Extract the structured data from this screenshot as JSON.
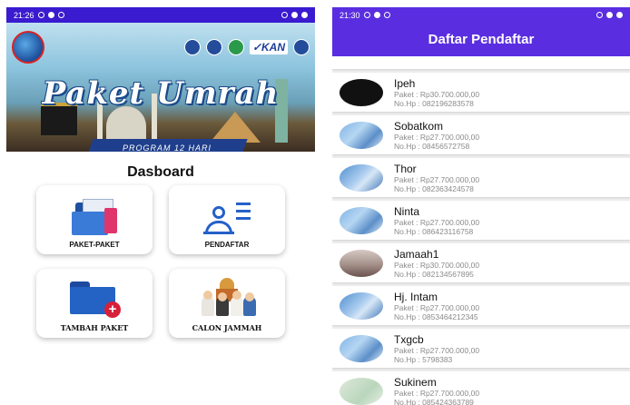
{
  "left_screen": {
    "status_time": "21:26",
    "banner": {
      "brand": "KAN",
      "title": "Paket Umrah",
      "program": "PROGRAM 12 HARI"
    },
    "dashboard_title": "Dasboard",
    "menu": [
      {
        "label": "PAKET-PAKET",
        "icon": "package-documents-icon"
      },
      {
        "label": "PENDAFTAR",
        "icon": "user-list-icon"
      },
      {
        "label": "TAMBAH PAKET",
        "icon": "folder-add-icon"
      },
      {
        "label": "CALON JAMMAH",
        "icon": "pilgrims-mosque-icon"
      }
    ]
  },
  "right_screen": {
    "status_time": "21:30",
    "title": "Daftar Pendaftar",
    "registrants": [
      {
        "name": "Ipeh",
        "paket": "Paket : Rp30.700.000,00",
        "hp": "No.Hp : 082196283578",
        "avatar": "black"
      },
      {
        "name": "Sobatkom",
        "paket": "Paket : Rp27.700.000,00",
        "hp": "No.Hp : 08456572758",
        "avatar": "card"
      },
      {
        "name": "Thor",
        "paket": "Paket : Rp27.700.000,00",
        "hp": "No.Hp : 082363424578",
        "avatar": "card2"
      },
      {
        "name": "Ninta",
        "paket": "Paket : Rp27.700.000,00",
        "hp": "No.Hp : 086423116758",
        "avatar": "card"
      },
      {
        "name": "Jamaah1",
        "paket": "Paket : Rp30.700.000,00",
        "hp": "No.Hp : 082134567895",
        "avatar": "room"
      },
      {
        "name": "Hj. Intam",
        "paket": "Paket : Rp27.700.000,00",
        "hp": "No.Hp : 0853464212345",
        "avatar": "card2"
      },
      {
        "name": "Txgcb",
        "paket": "Paket : Rp27.700.000,00",
        "hp": "No.Hp : 5798383",
        "avatar": "card"
      },
      {
        "name": "Sukinem",
        "paket": "Paket : Rp27.700.000,00",
        "hp": "No.Hp : 085424363789",
        "avatar": "green"
      }
    ]
  }
}
